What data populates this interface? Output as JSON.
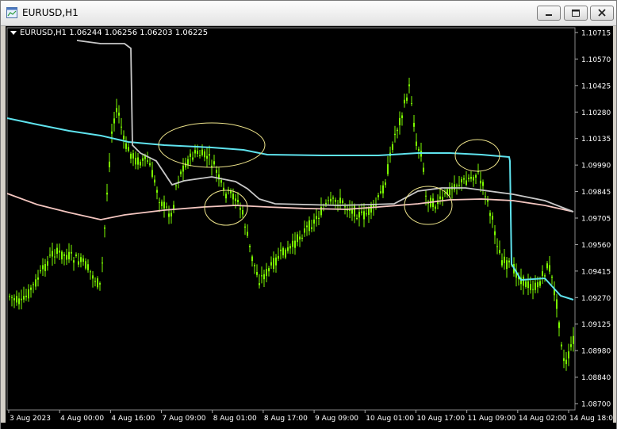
{
  "window": {
    "title": "EURUSD,H1",
    "icon": "chart-window-icon",
    "buttons": [
      "minimize-icon",
      "maximize-icon",
      "close-icon"
    ]
  },
  "chart_header": {
    "symbol_tf": "EURUSD,H1",
    "ohlc": "1.06244 1.06256 1.06203 1.06225"
  },
  "colors": {
    "background": "#000000",
    "candles": "#7CFC00",
    "ma_cyan": "#5fe3ee",
    "ma_silver": "#c8c8c8",
    "ma_pink": "#f4c6c0",
    "ellipse": "#f0e68c",
    "axis_text": "#ffffff"
  },
  "chart_data": {
    "type": "line",
    "price_ticks": [
      "1.10715",
      "1.10570",
      "1.10425",
      "1.10280",
      "1.10135",
      "1.09990",
      "1.09845",
      "1.09705",
      "1.09560",
      "1.09415",
      "1.09270",
      "1.09125",
      "1.08980",
      "1.08840",
      "1.08700"
    ],
    "time_ticks": [
      "3 Aug 2023",
      "4 Aug 00:00",
      "4 Aug 16:00",
      "7 Aug 09:00",
      "8 Aug 01:00",
      "8 Aug 17:00",
      "9 Aug 09:00",
      "10 Aug 01:00",
      "10 Aug 17:00",
      "11 Aug 09:00",
      "14 Aug 02:00",
      "14 Aug 18:00"
    ],
    "ylim": [
      1.087,
      1.10715
    ],
    "last_price": 1.06225
  }
}
